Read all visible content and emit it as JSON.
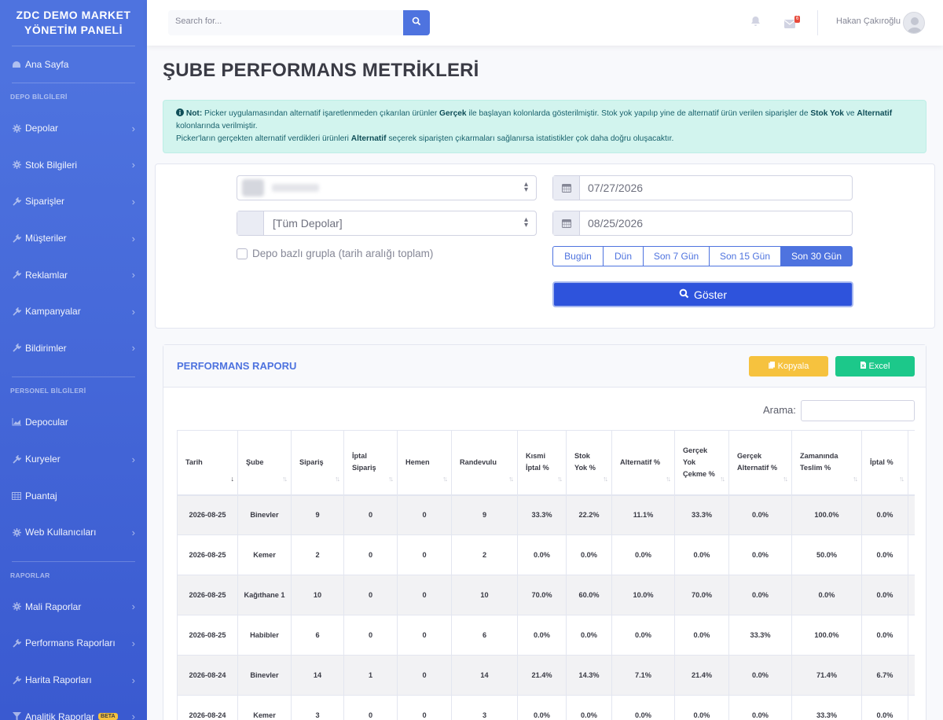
{
  "brand": "ZDC DEMO MARKET YÖNETİM PANELİ",
  "sidebar": {
    "home": {
      "label": "Ana Sayfa",
      "icon": "dashboard-icon"
    },
    "heading_depo": "DEPO BİLGİLERİ",
    "depo_items": [
      {
        "label": "Depolar",
        "icon": "gear-icon"
      },
      {
        "label": "Stok Bilgileri",
        "icon": "gear-icon"
      },
      {
        "label": "Siparişler",
        "icon": "wrench-icon"
      },
      {
        "label": "Müşteriler",
        "icon": "wrench-icon"
      },
      {
        "label": "Reklamlar",
        "icon": "wrench-icon"
      },
      {
        "label": "Kampanyalar",
        "icon": "wrench-icon"
      },
      {
        "label": "Bildirimler",
        "icon": "wrench-icon"
      }
    ],
    "heading_personel": "PERSONEL BİLGİLERİ",
    "personel_items": [
      {
        "label": "Depocular",
        "icon": "chart-area-icon"
      },
      {
        "label": "Kuryeler",
        "icon": "wrench-icon"
      },
      {
        "label": "Puantaj",
        "icon": "table-icon"
      },
      {
        "label": "Web Kullanıcıları",
        "icon": "gear-icon"
      }
    ],
    "heading_raporlar": "RAPORLAR",
    "rapor_items": [
      {
        "label": "Mali Raporlar",
        "icon": "gear-icon"
      },
      {
        "label": "Performans Raporları",
        "icon": "wrench-icon"
      },
      {
        "label": "Harita Raporları",
        "icon": "wrench-icon"
      },
      {
        "label": "Analitik Raporlar",
        "icon": "filter-icon",
        "badge": "BETA"
      }
    ]
  },
  "topbar": {
    "search_placeholder": "Search for...",
    "messages_count": "6",
    "user_name": "Hakan Çakıroğlu"
  },
  "page_title": "ŞUBE PERFORMANS METRİKLERİ",
  "alert": {
    "not_label": "Not:",
    "t1": " Picker uygulamasından alternatif işaretlenmeden çıkarılan ürünler ",
    "b1": "Gerçek",
    "t2": " ile başlayan kolonlarda gösterilmiştir. Stok yok yapılıp yine de alternatif ürün verilen siparişler de ",
    "b2": "Stok Yok",
    "t3": " ve ",
    "b3": "Alternatif",
    "t4": " kolonlarında verilmiştir.",
    "t5": "Picker'ların gerçekten alternatif verdikleri ürünleri ",
    "b4": "Alternatif",
    "t6": " seçerek siparişten çıkarmaları sağlanırsa istatistikler çok daha doğru oluşacaktır."
  },
  "filters": {
    "depo_select": "[Tüm Depolar]",
    "start_date": "07/27/2026",
    "end_date": "08/25/2026",
    "group_checkbox_label": "Depo bazlı grupla (tarih aralığı toplam)",
    "ranges": [
      "Bugün",
      "Dün",
      "Son 7 Gün",
      "Son 15 Gün",
      "Son 30 Gün"
    ],
    "show_button": "Göster"
  },
  "report": {
    "title": "PERFORMANS RAPORU",
    "copy_button": "Kopyala",
    "excel_button": "Excel",
    "search_label": "Arama:",
    "columns": [
      "Tarih",
      "Şube",
      "Sipariş",
      "İptal Sipariş",
      "Hemen",
      "Randevulu",
      "Kısmi İptal %",
      "Stok Yok %",
      "Alternatif %",
      "Gerçek Yok Çekme %",
      "Gerçek Alternatif %",
      "Zamanında Teslim %",
      "İptal %",
      ""
    ],
    "rows": [
      [
        "2026-08-25",
        "Binevler",
        "9",
        "0",
        "0",
        "9",
        "33.3%",
        "22.2%",
        "11.1%",
        "33.3%",
        "0.0%",
        "100.0%",
        "0.0%"
      ],
      [
        "2026-08-25",
        "Kemer",
        "2",
        "0",
        "0",
        "2",
        "0.0%",
        "0.0%",
        "0.0%",
        "0.0%",
        "0.0%",
        "50.0%",
        "0.0%"
      ],
      [
        "2026-08-25",
        "Kağıthane 1",
        "10",
        "0",
        "0",
        "10",
        "70.0%",
        "60.0%",
        "10.0%",
        "70.0%",
        "0.0%",
        "0.0%",
        "0.0%"
      ],
      [
        "2026-08-25",
        "Habibler",
        "6",
        "0",
        "0",
        "6",
        "0.0%",
        "0.0%",
        "0.0%",
        "0.0%",
        "33.3%",
        "100.0%",
        "0.0%"
      ],
      [
        "2026-08-24",
        "Binevler",
        "14",
        "1",
        "0",
        "14",
        "21.4%",
        "14.3%",
        "7.1%",
        "21.4%",
        "0.0%",
        "71.4%",
        "6.7%"
      ],
      [
        "2026-08-24",
        "Kemer",
        "3",
        "0",
        "0",
        "3",
        "0.0%",
        "0.0%",
        "0.0%",
        "0.0%",
        "0.0%",
        "33.3%",
        "0.0%"
      ]
    ]
  },
  "colors": {
    "primary": "#4e73df",
    "warning": "#f6c23e",
    "success": "#1cc88a",
    "info_bg": "#d2f4ee"
  }
}
